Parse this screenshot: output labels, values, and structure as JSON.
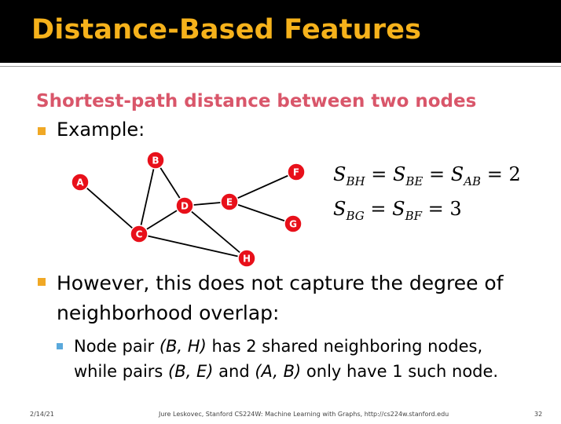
{
  "slide": {
    "title": "Distance-Based Features",
    "subtitle": "Shortest-path distance between two nodes",
    "bullet_example": "Example:",
    "bullet_however_line1": "However, this does not capture the degree of",
    "bullet_however_line2": "neighborhood overlap:",
    "sub_bullet": {
      "line1_parts": [
        "Node pair ",
        "(B, H)",
        " has 2 shared neighboring nodes,"
      ],
      "line2_parts": [
        "while pairs ",
        "(B, E)",
        " and ",
        "(A, B)",
        " only have 1 such node."
      ]
    }
  },
  "equations": {
    "line1": {
      "terms": [
        [
          "S",
          "BH"
        ],
        [
          "S",
          "BE"
        ],
        [
          "S",
          "AB"
        ]
      ],
      "value": "2"
    },
    "line2": {
      "terms": [
        [
          "S",
          "BG"
        ],
        [
          "S",
          "BF"
        ]
      ],
      "value": "3"
    }
  },
  "graph": {
    "nodes": [
      "A",
      "B",
      "C",
      "D",
      "E",
      "F",
      "G",
      "H"
    ],
    "edges": [
      [
        "A",
        "C"
      ],
      [
        "B",
        "C"
      ],
      [
        "B",
        "D"
      ],
      [
        "C",
        "D"
      ],
      [
        "C",
        "H"
      ],
      [
        "D",
        "E"
      ],
      [
        "D",
        "H"
      ],
      [
        "E",
        "F"
      ],
      [
        "E",
        "G"
      ]
    ],
    "node_color": "#e8101a"
  },
  "footer": {
    "date": "2/14/21",
    "credit": "Jure Leskovec, Stanford CS224W: Machine Learning with Graphs, http://cs224w.stanford.edu",
    "page": "32"
  },
  "colors": {
    "title": "#f6b21b",
    "subtitle": "#d9566a",
    "bullet": "#f0a825",
    "sub_bullet": "#5aa9dc"
  }
}
